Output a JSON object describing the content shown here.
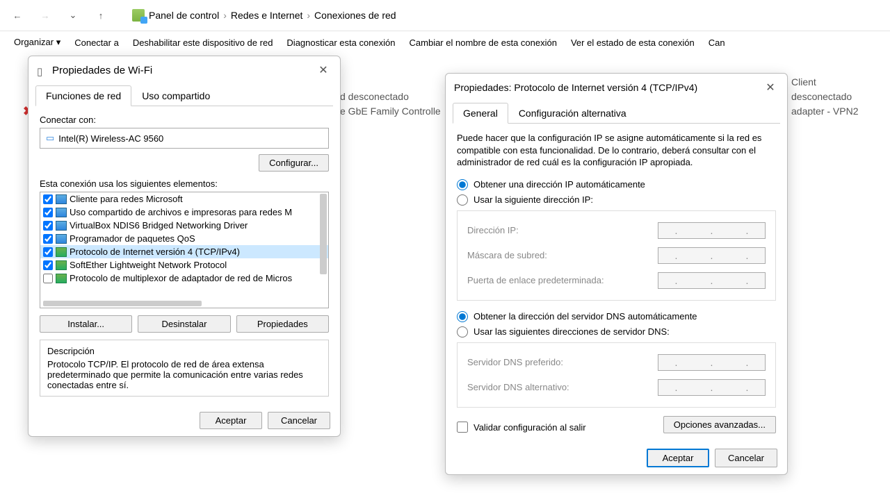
{
  "nav": {
    "breadcrumb": [
      "Panel de control",
      "Redes e Internet",
      "Conexiones de red"
    ]
  },
  "toolbar": {
    "organizar": "Organizar ▾",
    "conectar": "Conectar a",
    "deshabilitar": "Deshabilitar este dispositivo de red",
    "diagnosticar": "Diagnosticar esta conexión",
    "cambiar": "Cambiar el nombre de esta conexión",
    "ver": "Ver el estado de esta conexión",
    "can": "Can"
  },
  "bg": {
    "client": "Client",
    "desconectado1": "d desconectado",
    "gbe": "e GbE Family Controlle",
    "desconectado2": "desconectado",
    "adapter": "adapter - VPN2"
  },
  "wifi": {
    "title": "Propiedades de Wi-Fi",
    "tab1": "Funciones de red",
    "tab2": "Uso compartido",
    "conectar_con": "Conectar con:",
    "adapter": "Intel(R) Wireless-AC 9560",
    "configurar": "Configurar...",
    "usa_elementos": "Esta conexión usa los siguientes elementos:",
    "items": [
      {
        "checked": true,
        "icon": "blue",
        "label": "Cliente para redes Microsoft"
      },
      {
        "checked": true,
        "icon": "blue",
        "label": "Uso compartido de archivos e impresoras para redes M"
      },
      {
        "checked": true,
        "icon": "blue",
        "label": "VirtualBox NDIS6 Bridged Networking Driver"
      },
      {
        "checked": true,
        "icon": "blue",
        "label": "Programador de paquetes QoS"
      },
      {
        "checked": true,
        "icon": "green",
        "selected": true,
        "label": "Protocolo de Internet versión 4 (TCP/IPv4)"
      },
      {
        "checked": true,
        "icon": "green",
        "label": "SoftEther Lightweight Network Protocol"
      },
      {
        "checked": false,
        "icon": "green",
        "label": "Protocolo de multiplexor de adaptador de red de Micros"
      }
    ],
    "instalar": "Instalar...",
    "desinstalar": "Desinstalar",
    "propiedades": "Propiedades",
    "desc_title": "Descripción",
    "desc_text": "Protocolo TCP/IP. El protocolo de red de área extensa predeterminado que permite la comunicación entre varias redes conectadas entre sí.",
    "aceptar": "Aceptar",
    "cancelar": "Cancelar"
  },
  "ipv4": {
    "title": "Propiedades: Protocolo de Internet versión 4 (TCP/IPv4)",
    "tab1": "General",
    "tab2": "Configuración alternativa",
    "intro": "Puede hacer que la configuración IP se asigne automáticamente si la red es compatible con esta funcionalidad. De lo contrario, deberá consultar con el administrador de red cuál es la configuración IP apropiada.",
    "auto_ip": "Obtener una dirección IP automáticamente",
    "manual_ip": "Usar la siguiente dirección IP:",
    "ip_label": "Dirección IP:",
    "mask_label": "Máscara de subred:",
    "gateway_label": "Puerta de enlace predeterminada:",
    "auto_dns": "Obtener la dirección del servidor DNS automáticamente",
    "manual_dns": "Usar las siguientes direcciones de servidor DNS:",
    "dns1_label": "Servidor DNS preferido:",
    "dns2_label": "Servidor DNS alternativo:",
    "validar": "Validar configuración al salir",
    "avanzadas": "Opciones avanzadas...",
    "aceptar": "Aceptar",
    "cancelar": "Cancelar"
  }
}
